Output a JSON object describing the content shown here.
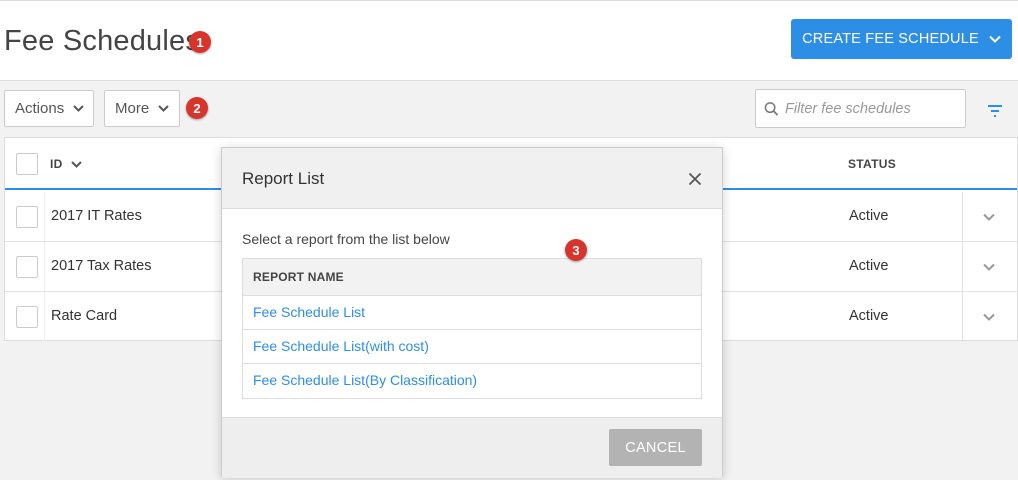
{
  "header": {
    "title": "Fee Schedules",
    "create_label": "CREATE FEE SCHEDULE"
  },
  "toolbar": {
    "actions_label": "Actions",
    "more_label": "More",
    "filter_placeholder": "Filter fee schedules"
  },
  "table": {
    "columns": [
      "ID",
      "STATUS"
    ],
    "rows": [
      {
        "name": "2017 IT Rates",
        "status": "Active"
      },
      {
        "name": "2017 Tax Rates",
        "status": "Active"
      },
      {
        "name": "Rate Card",
        "status": "Active"
      }
    ]
  },
  "modal": {
    "title": "Report List",
    "description": "Select a report from the list below",
    "column_header": "REPORT NAME",
    "reports": [
      "Fee Schedule List",
      "Fee Schedule List(with cost)",
      "Fee Schedule List(By Classification)"
    ],
    "cancel_label": "CANCEL"
  },
  "badges": [
    "1",
    "2",
    "3"
  ],
  "colors": {
    "accent": "#2d8ee6",
    "badge": "#d9342b",
    "cancel": "#b3b3b3"
  },
  "icons": {
    "chevron": "chevron-down-icon",
    "search": "search-icon",
    "filter": "filter-icon",
    "close": "close-icon"
  }
}
